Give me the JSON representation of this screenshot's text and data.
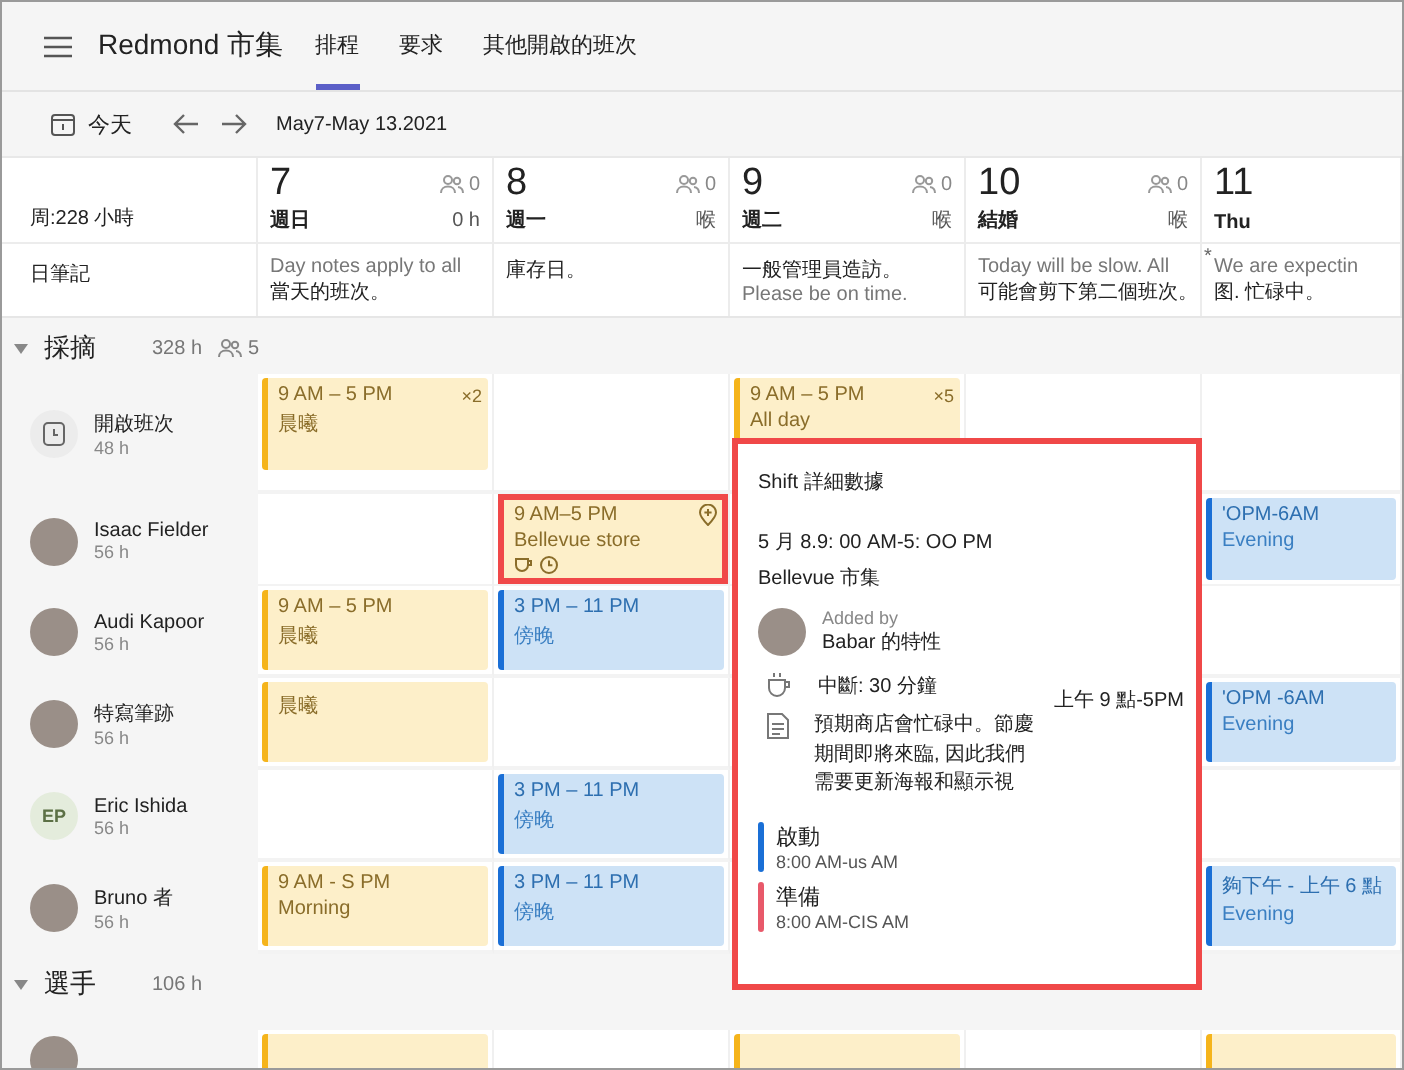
{
  "app": {
    "title": "Redmond 市集"
  },
  "tabs": [
    {
      "label": "排程",
      "selected": true
    },
    {
      "label": "要求",
      "selected": false
    },
    {
      "label": "其他開啟的班次",
      "selected": false
    }
  ],
  "toolbar": {
    "today": "今天",
    "date_range": "May7-May 13.2021"
  },
  "week": {
    "total": "周:228 小時",
    "notes_label": "日筆記"
  },
  "days": [
    {
      "number": "7",
      "people": "0",
      "weekday": "週日",
      "hours": "0 h",
      "notes": [
        {
          "text": "Day notes apply to all",
          "muted": true
        },
        {
          "text": "當天的班次。",
          "muted": false
        }
      ]
    },
    {
      "number": "8",
      "people": "0",
      "weekday": "週一",
      "hours": "喉",
      "notes": [
        {
          "text": "庫存日。",
          "muted": false
        }
      ]
    },
    {
      "number": "9",
      "people": "0",
      "weekday": "週二",
      "hours": "喉",
      "notes": [
        {
          "text": "一般管理員造訪。",
          "muted": false
        },
        {
          "text": "Please be on time.",
          "muted": true
        }
      ]
    },
    {
      "number": "10",
      "people": "0",
      "weekday": "結婚",
      "hours": "喉",
      "notes": [
        {
          "text": "Today will be slow. All",
          "muted": true
        },
        {
          "text": "可能會剪下第二個班次。",
          "muted": false
        }
      ]
    },
    {
      "number": "11",
      "weekday": "Thu",
      "star": "*",
      "notes": [
        {
          "text": "We are expectin",
          "muted": true
        },
        {
          "text": "图. 忙碌中。",
          "muted": false
        }
      ]
    }
  ],
  "groups": [
    {
      "name": "採摘",
      "hours": "328 h",
      "people": "5",
      "expanded": true,
      "rows": [
        {
          "name": "開啟班次",
          "hours": "48 h",
          "kind": "open",
          "cells": [
            {
              "kind": "day",
              "time": "9 AM – 5 PM",
              "count": "×2",
              "label": "晨曦"
            },
            null,
            {
              "kind": "day",
              "time": "9 AM – 5 PM",
              "count": "×5",
              "label": "All day"
            },
            null,
            null
          ]
        },
        {
          "name": "Isaac Fielder",
          "hours": "56 h",
          "kind": "photo",
          "cells": [
            null,
            {
              "kind": "day",
              "time": "9 AM–5 PM",
              "label": "Bellevue store",
              "pin": true,
              "extras": true,
              "highlighted": true
            },
            null,
            null,
            {
              "kind": "evening",
              "time": "'OPM-6AM",
              "label": "Evening"
            }
          ]
        },
        {
          "name": "Audi Kapoor",
          "hours": "56 h",
          "kind": "photo",
          "cells": [
            {
              "kind": "day",
              "time": "9 AM – 5 PM",
              "label": "晨曦"
            },
            {
              "kind": "evening",
              "time": "3 PM – 11 PM",
              "label": "傍晚"
            },
            null,
            null,
            null
          ]
        },
        {
          "name": "特寫筆跡",
          "hours": "56 h",
          "kind": "photo",
          "cells": [
            {
              "kind": "day",
              "label": "晨曦"
            },
            null,
            null,
            {
              "kind": "text",
              "label": "上午 9 點-5PM"
            },
            {
              "kind": "evening",
              "time": "'OPM -6AM",
              "label": "Evening"
            }
          ]
        },
        {
          "name": "Eric Ishida",
          "hours": "56 h",
          "kind": "initials",
          "initials": "EP",
          "cells": [
            null,
            {
              "kind": "evening",
              "time": "3 PM – 11 PM",
              "label": "傍晚"
            },
            null,
            null,
            null
          ]
        },
        {
          "name": "Bruno 者",
          "hours": "56 h",
          "kind": "photo",
          "cells": [
            {
              "kind": "day",
              "time": "9 AM - S PM",
              "label": "Morning"
            },
            {
              "kind": "evening",
              "time": "3 PM – 11 PM",
              "label": "傍晚"
            },
            null,
            null,
            {
              "kind": "evening",
              "time": "夠下午 - 上午 6 點",
              "label": "Evening"
            }
          ]
        }
      ]
    },
    {
      "name": "選手",
      "hours": "106 h",
      "expanded": true,
      "rows": [
        {
          "kind": "photo",
          "cells": [
            {
              "kind": "stub"
            },
            null,
            {
              "kind": "stub"
            },
            null,
            {
              "kind": "stub"
            }
          ]
        }
      ]
    }
  ],
  "popover": {
    "title": "Shift 詳細數據",
    "time": "5 月 8.9: 00 AM-5: OO PM",
    "location": "Bellevue 市集",
    "added_by_label": "Added by",
    "added_by": "Babar 的特性",
    "break": "中斷: 30 分鐘",
    "note": "預期商店會忙碌中。節慶期間即將來臨, 因此我們需要更新海報和顯示視",
    "activities": [
      {
        "name": "啟動",
        "time": "8:00 AM-us AM",
        "color": "#1a6fd6"
      },
      {
        "name": "準備",
        "time": "8:00 AM-CIS AM",
        "color": "#e8596a"
      }
    ]
  }
}
